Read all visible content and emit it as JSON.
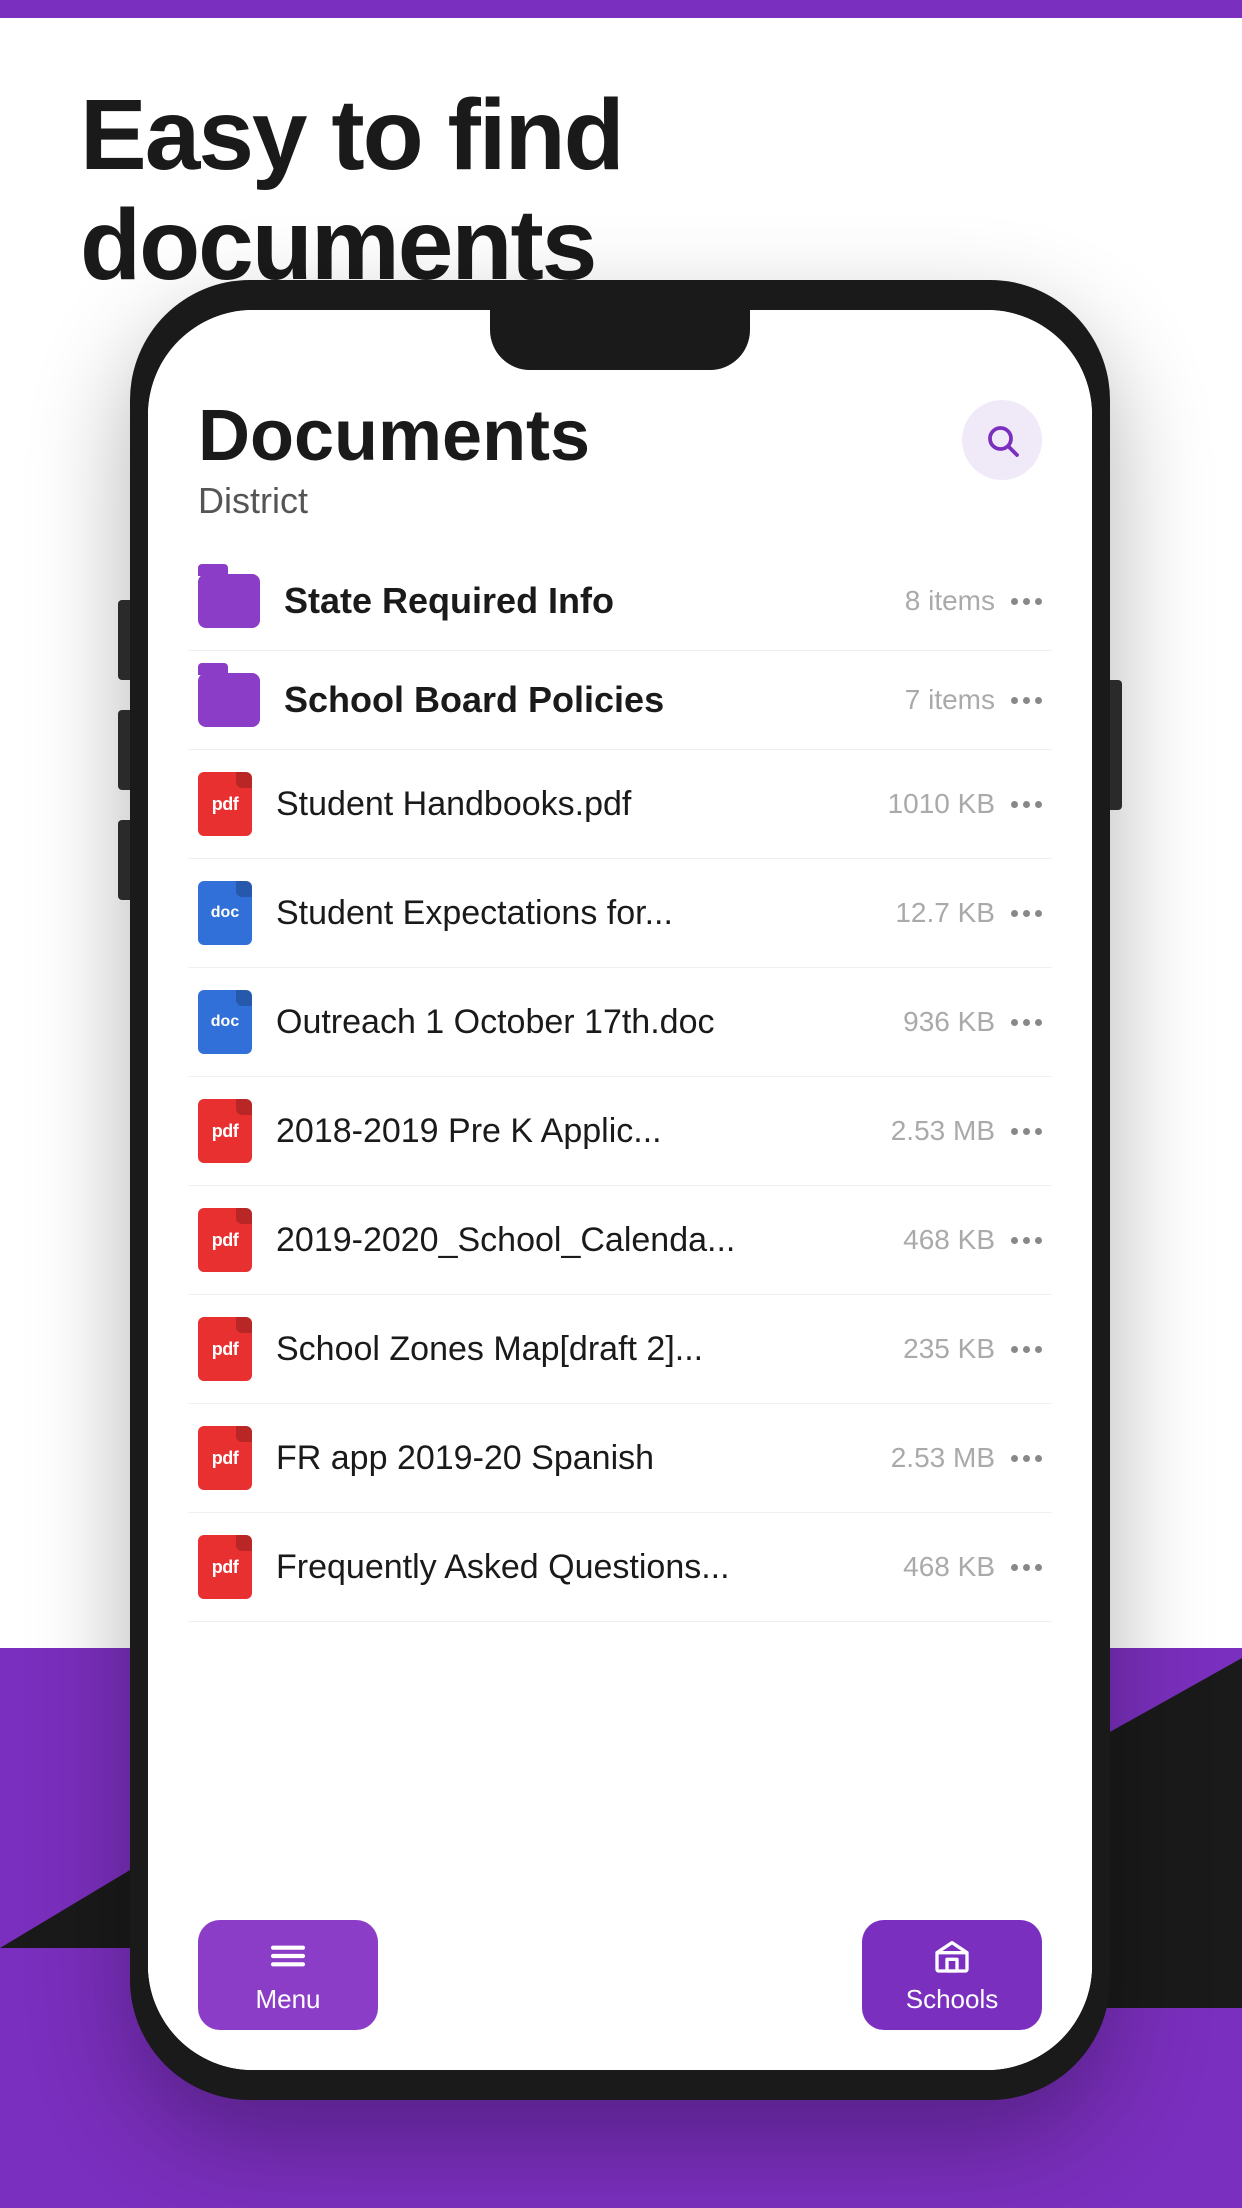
{
  "page": {
    "title": "Easy to find documents",
    "bg_top_color": "#7B2FBE",
    "bg_bottom_color": "#7B2FBE"
  },
  "app": {
    "header": {
      "title": "Documents",
      "subtitle": "District",
      "search_label": "search"
    },
    "items": [
      {
        "type": "folder",
        "name": "State Required Info",
        "size": "8 items",
        "icon_type": "folder"
      },
      {
        "type": "folder",
        "name": "School Board Policies",
        "size": "7 items",
        "icon_type": "folder"
      },
      {
        "type": "file",
        "name": "Student Handbooks.pdf",
        "size": "1010 KB",
        "icon_type": "pdf"
      },
      {
        "type": "file",
        "name": "Student Expectations for...",
        "size": "12.7 KB",
        "icon_type": "doc"
      },
      {
        "type": "file",
        "name": "Outreach 1 October 17th.doc",
        "size": "936 KB",
        "icon_type": "doc"
      },
      {
        "type": "file",
        "name": "2018-2019 Pre K Applic...",
        "size": "2.53 MB",
        "icon_type": "pdf"
      },
      {
        "type": "file",
        "name": "2019-2020_School_Calenda...",
        "size": "468 KB",
        "icon_type": "pdf"
      },
      {
        "type": "file",
        "name": "School Zones Map[draft 2]...",
        "size": "235 KB",
        "icon_type": "pdf"
      },
      {
        "type": "file",
        "name": "FR app 2019-20 Spanish",
        "size": "2.53 MB",
        "icon_type": "pdf"
      },
      {
        "type": "file",
        "name": "Frequently Asked Questions...",
        "size": "468 KB",
        "icon_type": "pdf"
      }
    ],
    "nav": {
      "menu_label": "Menu",
      "schools_label": "Schools"
    }
  }
}
